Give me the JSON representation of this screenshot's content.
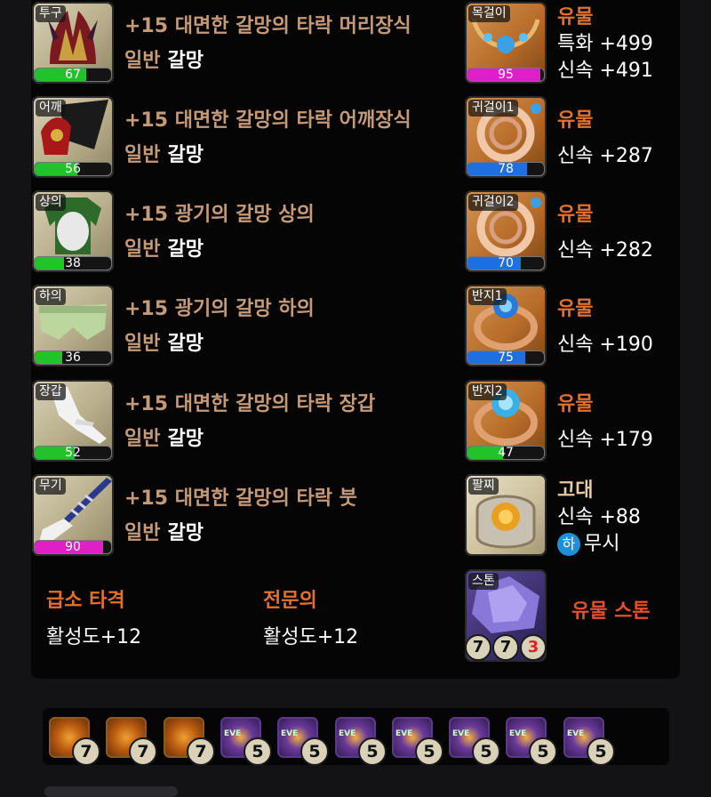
{
  "equipment": [
    {
      "slot": "투구",
      "name": "+15 대면한 갈망의 타락 머리장식",
      "grade": "일반",
      "set": "갈망",
      "quality": 67,
      "bar_color": "#22c22a"
    },
    {
      "slot": "어깨",
      "name": "+15 대면한 갈망의 타락 어깨장식",
      "grade": "일반",
      "set": "갈망",
      "quality": 56,
      "bar_color": "#22c22a"
    },
    {
      "slot": "상의",
      "name": "+15 광기의 갈망 상의",
      "grade": "일반",
      "set": "갈망",
      "quality": 38,
      "bar_color": "#22c22a"
    },
    {
      "slot": "하의",
      "name": "+15 광기의 갈망 하의",
      "grade": "일반",
      "set": "갈망",
      "quality": 36,
      "bar_color": "#22c22a"
    },
    {
      "slot": "장갑",
      "name": "+15 대면한 갈망의 타락 장갑",
      "grade": "일반",
      "set": "갈망",
      "quality": 52,
      "bar_color": "#22c22a"
    },
    {
      "slot": "무기",
      "name": "+15 대면한 갈망의 타락 붓",
      "grade": "일반",
      "set": "갈망",
      "quality": 90,
      "bar_color": "#e01fc8"
    }
  ],
  "accessories": [
    {
      "slot": "목걸이",
      "grade": "유물",
      "stat1": "특화 +499",
      "stat2": "신속 +491",
      "quality": 95,
      "bar_color": "#e01fc8"
    },
    {
      "slot": "귀걸이1",
      "grade": "유물",
      "stat1": "신속 +287",
      "quality": 78,
      "bar_color": "#1f6fe0"
    },
    {
      "slot": "귀걸이2",
      "grade": "유물",
      "stat1": "신속 +282",
      "quality": 70,
      "bar_color": "#1f6fe0"
    },
    {
      "slot": "반지1",
      "grade": "유물",
      "stat1": "신속 +190",
      "quality": 75,
      "bar_color": "#1f6fe0"
    },
    {
      "slot": "반지2",
      "grade": "유물",
      "stat1": "신속 +179",
      "quality": 47,
      "bar_color": "#22c22a"
    }
  ],
  "bracelet": {
    "slot": "팔찌",
    "grade": "고대",
    "stat1": "신속 +88",
    "badge": "하",
    "effect": "무시"
  },
  "engravings": [
    {
      "name": "급소 타격",
      "value": "활성도+12"
    },
    {
      "name": "전문의",
      "value": "활성도+12"
    }
  ],
  "stone": {
    "slot": "스톤",
    "label": "유물 스톤",
    "counts": [
      "7",
      "7",
      "3"
    ]
  },
  "gems": [
    {
      "type": "orange",
      "level": "7"
    },
    {
      "type": "orange",
      "level": "7"
    },
    {
      "type": "orange",
      "level": "7"
    },
    {
      "type": "purple",
      "level": "5"
    },
    {
      "type": "purple",
      "level": "5"
    },
    {
      "type": "purple",
      "level": "5"
    },
    {
      "type": "purple",
      "level": "5"
    },
    {
      "type": "purple",
      "level": "5"
    },
    {
      "type": "purple",
      "level": "5"
    },
    {
      "type": "purple",
      "level": "5"
    }
  ],
  "gem_overlay_text": "EVE"
}
